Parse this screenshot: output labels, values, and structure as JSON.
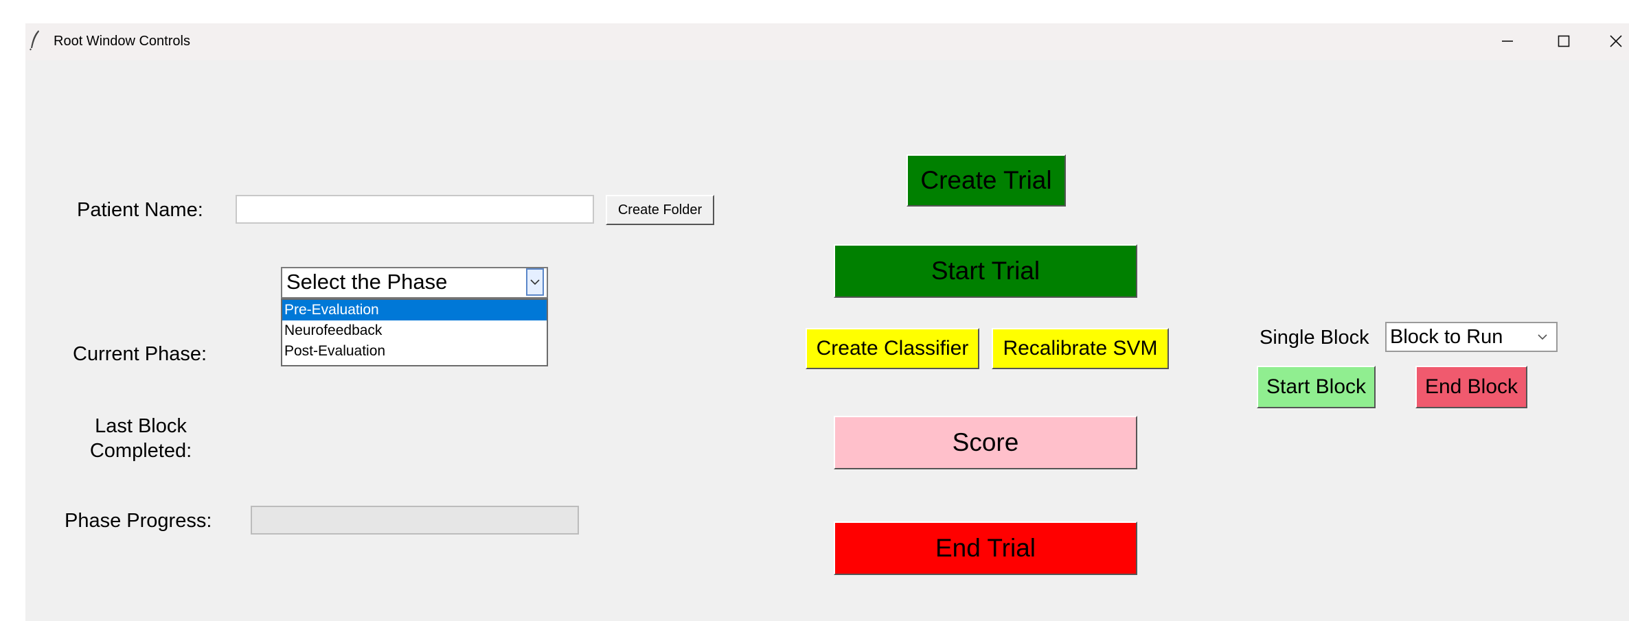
{
  "window": {
    "title": "Root Window Controls",
    "icons": {
      "app": "feather-icon",
      "minimize": "minimize-icon",
      "maximize": "maximize-icon",
      "close": "close-icon"
    }
  },
  "patient": {
    "label": "Patient Name:",
    "value": "",
    "create_folder": "Create Folder"
  },
  "phase": {
    "label": "Current Phase:",
    "combo_value": "Select the Phase",
    "options": [
      "Pre-Evaluation",
      "Neurofeedback",
      "Post-Evaluation"
    ],
    "highlighted_index": 0
  },
  "last_block": {
    "label_line1": "Last Block",
    "label_line2": "Completed:"
  },
  "progress": {
    "label": "Phase Progress:",
    "value": 0
  },
  "center_buttons": {
    "create_trial": "Create Trial",
    "start_trial": "Start Trial",
    "create_classifier": "Create Classifier",
    "recalibrate_svm": "Recalibrate SVM",
    "score": "Score",
    "end_trial": "End Trial"
  },
  "single_block": {
    "label": "Single Block",
    "combo_value": "Block to Run",
    "start": "Start Block",
    "end": "End Block"
  },
  "colors": {
    "create_trial": "#008000",
    "start_trial": "#008000",
    "classifier": "#ffff00",
    "score": "#ffc0cb",
    "end_trial": "#ff0000",
    "start_block": "#90ee90",
    "end_block": "#f05a6e",
    "selection": "#0078d7"
  }
}
